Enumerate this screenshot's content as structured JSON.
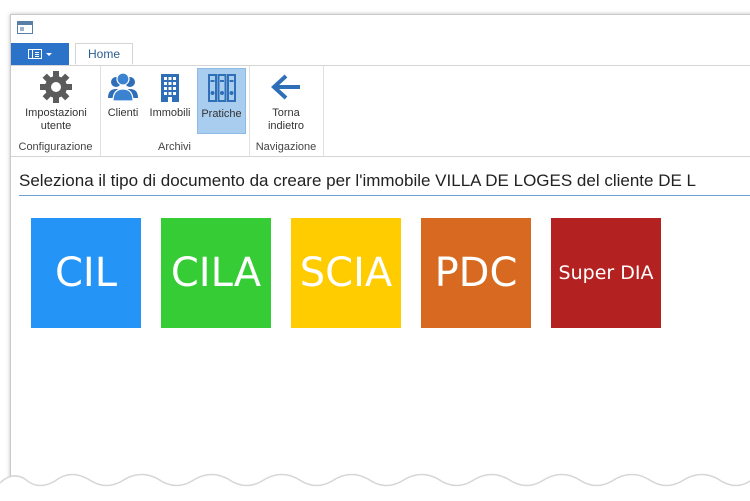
{
  "ribbon": {
    "tab_home": "Home",
    "groups": {
      "configurazione": {
        "label": "Configurazione",
        "buttons": {
          "impostazioni_line1": "Impostazioni",
          "impostazioni_line2": "utente"
        }
      },
      "archivi": {
        "label": "Archivi",
        "buttons": {
          "clienti": "Clienti",
          "immobili": "Immobili",
          "pratiche": "Pratiche"
        }
      },
      "navigazione": {
        "label": "Navigazione",
        "buttons": {
          "torna_line1": "Torna",
          "torna_line2": "indietro"
        }
      }
    }
  },
  "main": {
    "prompt": "Seleziona il tipo di documento da creare per l'immobile VILLA DE LOGES del cliente DE L",
    "tiles": [
      {
        "label": "CIL",
        "color": "#2594f7"
      },
      {
        "label": "CILA",
        "color": "#35cc35"
      },
      {
        "label": "SCIA",
        "color": "#ffcc00"
      },
      {
        "label": "PDC",
        "color": "#d76a20"
      },
      {
        "label": "Super DIA",
        "color": "#b32121"
      }
    ]
  },
  "colors": {
    "accent": "#2b73c9",
    "selected_button": "#a9cdef"
  }
}
